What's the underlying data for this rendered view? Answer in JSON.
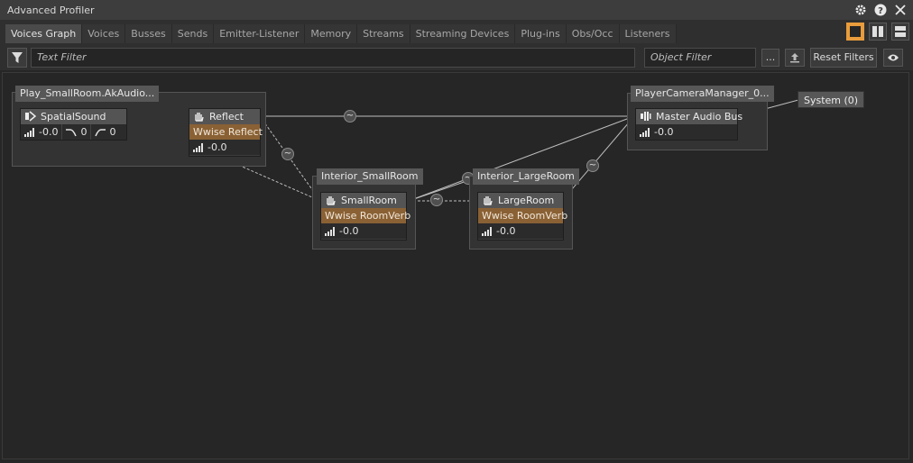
{
  "window": {
    "title": "Advanced Profiler"
  },
  "tabs": [
    "Voices Graph",
    "Voices",
    "Busses",
    "Sends",
    "Emitter-Listener",
    "Memory",
    "Streams",
    "Streaming Devices",
    "Plug-ins",
    "Obs/Occ",
    "Listeners"
  ],
  "filters": {
    "text_placeholder": "Text Filter",
    "object_placeholder": "Object Filter",
    "browse_label": "...",
    "reset_label": "Reset Filters"
  },
  "graph": {
    "play_group": "Play_SmallRoom.AkAudio...",
    "spatial_sound": {
      "name": "SpatialSound",
      "volume": "-0.0",
      "lpf": "0",
      "hpf": "0"
    },
    "reflect": {
      "name": "Reflect",
      "effect": "Wwise Reflect",
      "volume": "-0.0"
    },
    "interior_small": "Interior_SmallRoom",
    "small_room": {
      "name": "SmallRoom",
      "effect": "Wwise RoomVerb",
      "volume": "-0.0"
    },
    "interior_large": "Interior_LargeRoom",
    "large_room": {
      "name": "LargeRoom",
      "effect": "Wwise RoomVerb",
      "volume": "-0.0"
    },
    "camera_group": "PlayerCameraManager_0...",
    "master_bus": {
      "name": "Master Audio Bus",
      "volume": "-0.0"
    },
    "system": "System (0)"
  }
}
